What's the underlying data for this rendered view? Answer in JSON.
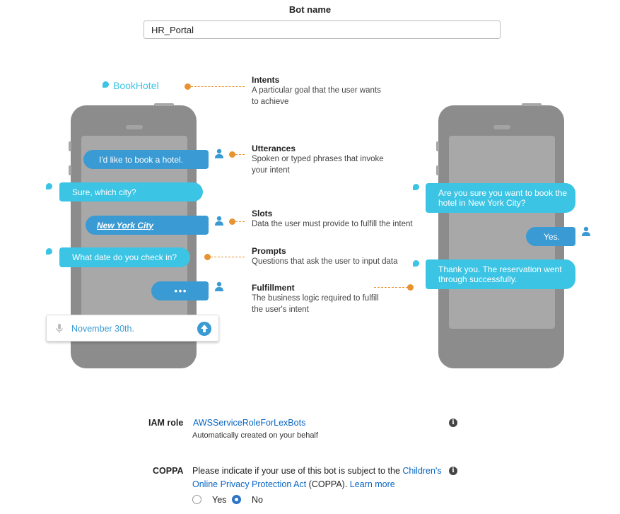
{
  "bot_name": {
    "label": "Bot name",
    "value": "HR_Portal"
  },
  "diagram": {
    "intent_chip": "BookHotel",
    "labels": [
      {
        "title": "Intents",
        "desc": [
          "A particular goal that the user wants",
          "to achieve"
        ]
      },
      {
        "title": "Utterances",
        "desc": [
          "Spoken or typed phrases that invoke",
          "your intent"
        ]
      },
      {
        "title": "Slots",
        "desc": [
          "Data the user must provide to fulfill the intent"
        ]
      },
      {
        "title": "Prompts",
        "desc": [
          "Questions that ask the user to input data"
        ]
      },
      {
        "title": "Fulfillment",
        "desc": [
          "The business logic required to fulfill",
          "the user's intent"
        ]
      }
    ],
    "left_chat": {
      "user_1": "I'd like to book a hotel.",
      "bot_1": "Sure, which city?",
      "slot_value": "New York City",
      "bot_2": "What date do you check in?",
      "typing": "• • •",
      "input_text": "November 30th."
    },
    "right_chat": {
      "bot_1": [
        "Are you sure you want to book the",
        "hotel in New York City?"
      ],
      "user_1": "Yes.",
      "bot_2": [
        "Thank you. The reservation went",
        "through successfully."
      ]
    },
    "colors": {
      "bot_bubble": "#3cc4e4",
      "user_bubble": "#3a9ad3",
      "connector": "#e8932f",
      "phone": "#8c8c8c"
    }
  },
  "iam_role": {
    "label": "IAM role",
    "value": "AWSServiceRoleForLexBots",
    "help": "Automatically created on your behalf"
  },
  "coppa": {
    "label": "COPPA",
    "text_1": "Please indicate if your use of this bot is subject to the",
    "link_1a": "Children's",
    "link_1b": "Online Privacy Protection Act",
    "text_2": "(COPPA).",
    "learn_more": "Learn more",
    "options": [
      "Yes",
      "No"
    ],
    "selected": "No"
  }
}
